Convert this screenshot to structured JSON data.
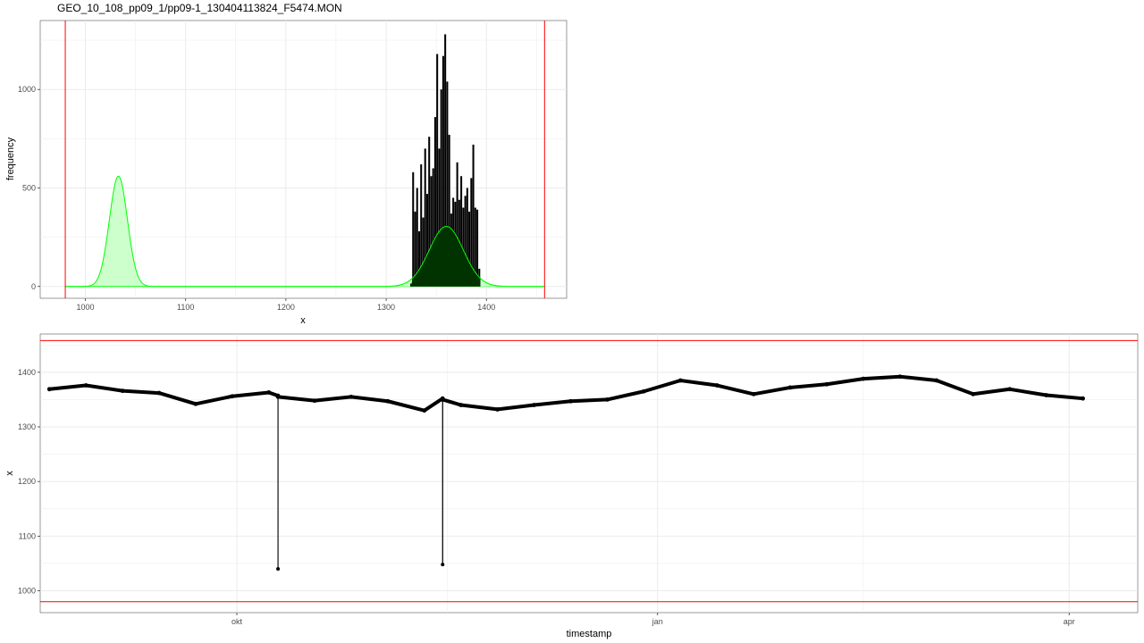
{
  "chart_data": [
    {
      "type": "histogram",
      "title": "GEO_10_108_pp09_1/pp09-1_130404113824_F5474.MON",
      "xlabel": "x",
      "ylabel": "frequency",
      "xlim": [
        955,
        1480
      ],
      "ylim": [
        -60,
        1350
      ],
      "xticks": [
        1000,
        1100,
        1200,
        1300,
        1400
      ],
      "yticks": [
        0,
        500,
        1000
      ],
      "grid": true,
      "vlines": [
        980,
        1458
      ],
      "vline_color": "#ff0000",
      "density_color": "#00ff00",
      "density_fill": "#ccffcc",
      "overlap_fill": "#003300",
      "densities": [
        {
          "mean": 1033,
          "sd": 9,
          "peak": 560
        },
        {
          "mean": 1360,
          "sd": 17,
          "peak": 305
        }
      ],
      "bins": {
        "x": [
          1325,
          1327,
          1329,
          1331,
          1333,
          1335,
          1337,
          1339,
          1341,
          1343,
          1345,
          1347,
          1349,
          1351,
          1353,
          1355,
          1357,
          1359,
          1361,
          1363,
          1365,
          1367,
          1369,
          1371,
          1373,
          1375,
          1377,
          1379,
          1381,
          1383,
          1385,
          1387,
          1389,
          1391,
          1393
        ],
        "values": [
          15,
          580,
          380,
          500,
          280,
          620,
          350,
          700,
          470,
          760,
          560,
          600,
          860,
          1180,
          700,
          1000,
          1170,
          1280,
          1040,
          770,
          370,
          450,
          430,
          630,
          440,
          560,
          400,
          460,
          500,
          380,
          550,
          720,
          400,
          390,
          90
        ]
      }
    },
    {
      "type": "line",
      "xlabel": "timestamp",
      "ylabel": "x",
      "ylim": [
        960,
        1470
      ],
      "yticks": [
        1000,
        1100,
        1200,
        1300,
        1400
      ],
      "xticks": [
        "okt",
        "jan",
        "apr"
      ],
      "x_tick_days": [
        0,
        92,
        182
      ],
      "x_range_days": [
        -43,
        197
      ],
      "grid": true,
      "hlines": [
        980,
        1458
      ],
      "hline_color": "#ff0000",
      "line_color": "#000000",
      "x": [
        "2012-08-21",
        "2012-08-29",
        "2012-09-06",
        "2012-09-14",
        "2012-09-22",
        "2012-09-30",
        "2012-10-08",
        "2012-10-10",
        "2012-10-10",
        "2012-10-10",
        "2012-10-18",
        "2012-10-26",
        "2012-11-03",
        "2012-11-11",
        "2012-11-15",
        "2012-11-15",
        "2012-11-15",
        "2012-11-19",
        "2012-11-27",
        "2012-12-05",
        "2012-12-13",
        "2012-12-21",
        "2012-12-29",
        "2013-01-06",
        "2013-01-14",
        "2013-01-22",
        "2013-01-30",
        "2013-02-07",
        "2013-02-15",
        "2013-02-23",
        "2013-03-03",
        "2013-03-11",
        "2013-03-19",
        "2013-03-27",
        "2013-04-04"
      ],
      "y": [
        1369,
        1376,
        1366,
        1362,
        1342,
        1356,
        1363,
        1357,
        1040,
        1355,
        1348,
        1355,
        1347,
        1330,
        1352,
        1048,
        1350,
        1340,
        1332,
        1340,
        1347,
        1350,
        1365,
        1385,
        1376,
        1360,
        1372,
        1378,
        1388,
        1392,
        1385,
        1360,
        1369,
        1358,
        1352
      ]
    }
  ]
}
